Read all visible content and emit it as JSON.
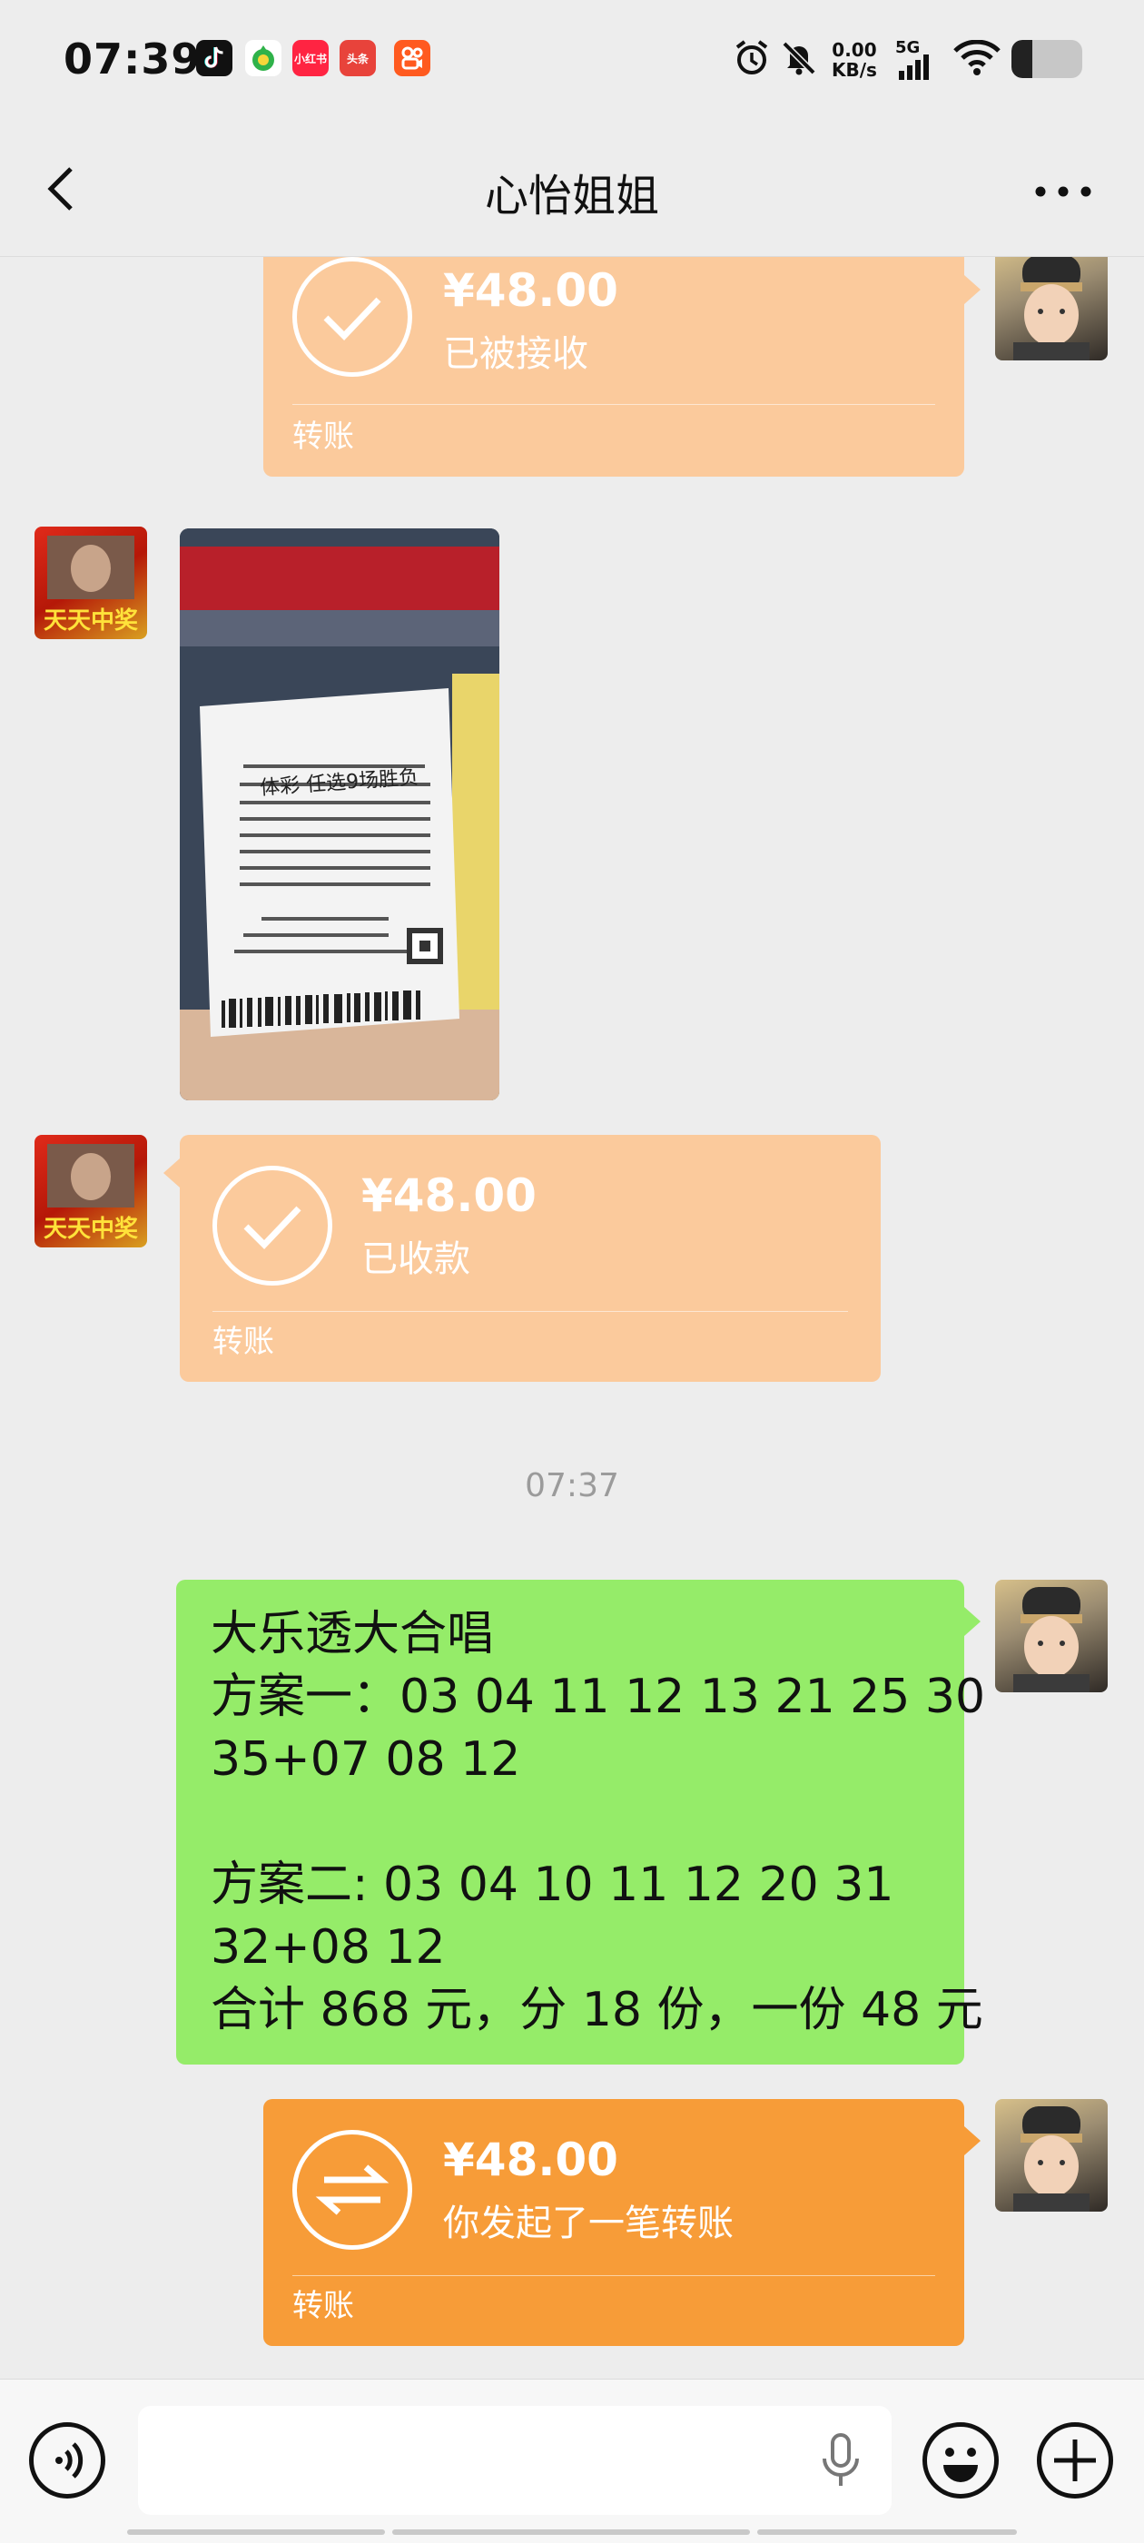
{
  "status_bar": {
    "time": "07:39",
    "apps": [
      {
        "icon": "tiktok-icon",
        "label": "",
        "color": "#111111"
      },
      {
        "icon": "lottery-app-icon",
        "label": "",
        "color": "#2fb24a"
      },
      {
        "icon": "xiaohongshu-icon",
        "label": "小红书",
        "color": "#ff2442"
      },
      {
        "icon": "toutiao-icon",
        "label": "头条",
        "color": "#e8433b"
      },
      {
        "icon": "kuaishou-icon",
        "label": "",
        "color": "#ff5a1f"
      }
    ],
    "net_speed_value": "0.00",
    "net_speed_unit": "KB/s",
    "network_type": "5G",
    "battery_level": 0.3
  },
  "header": {
    "title": "心怡姐姐",
    "back_icon": "back-arrow-icon",
    "more_icon": "more-icon"
  },
  "messages": [
    {
      "type": "transfer",
      "side": "right",
      "amount": "¥48.00",
      "status": "已被接收",
      "footer": "转账",
      "icon": "check-icon"
    },
    {
      "type": "image",
      "side": "left",
      "description_icon": "lottery-ticket-photo"
    },
    {
      "type": "transfer",
      "side": "left",
      "amount": "¥48.00",
      "status": "已收款",
      "footer": "转账",
      "icon": "check-icon"
    },
    {
      "type": "timestamp",
      "text": "07:37"
    },
    {
      "type": "text",
      "side": "right",
      "lines": [
        "大乐透大合唱",
        "方案一：03 04 11 12 13 21 25 30",
        "35+07 08 12",
        "",
        "方案二: 03 04 10 11 12 20 31",
        "32+08 12",
        "合计 868 元，分 18 份，一份 48 元"
      ]
    },
    {
      "type": "transfer",
      "side": "right",
      "amount": "¥48.00",
      "status": "你发起了一笔转账",
      "footer": "转账",
      "icon": "exchange-icon"
    }
  ],
  "ticket": {
    "title": "体彩 任选9场胜负"
  },
  "other_avatar_text": "天天中奖",
  "input_bar": {
    "voice_icon": "voice-icon",
    "mic_icon": "microphone-icon",
    "emoji_icon": "emoji-icon",
    "add_icon": "add-icon",
    "input_value": ""
  },
  "colors": {
    "background": "#ededed",
    "transfer_received": "#fbca9c",
    "transfer_pending": "#f79c38",
    "text_bubble": "#95ec69"
  }
}
